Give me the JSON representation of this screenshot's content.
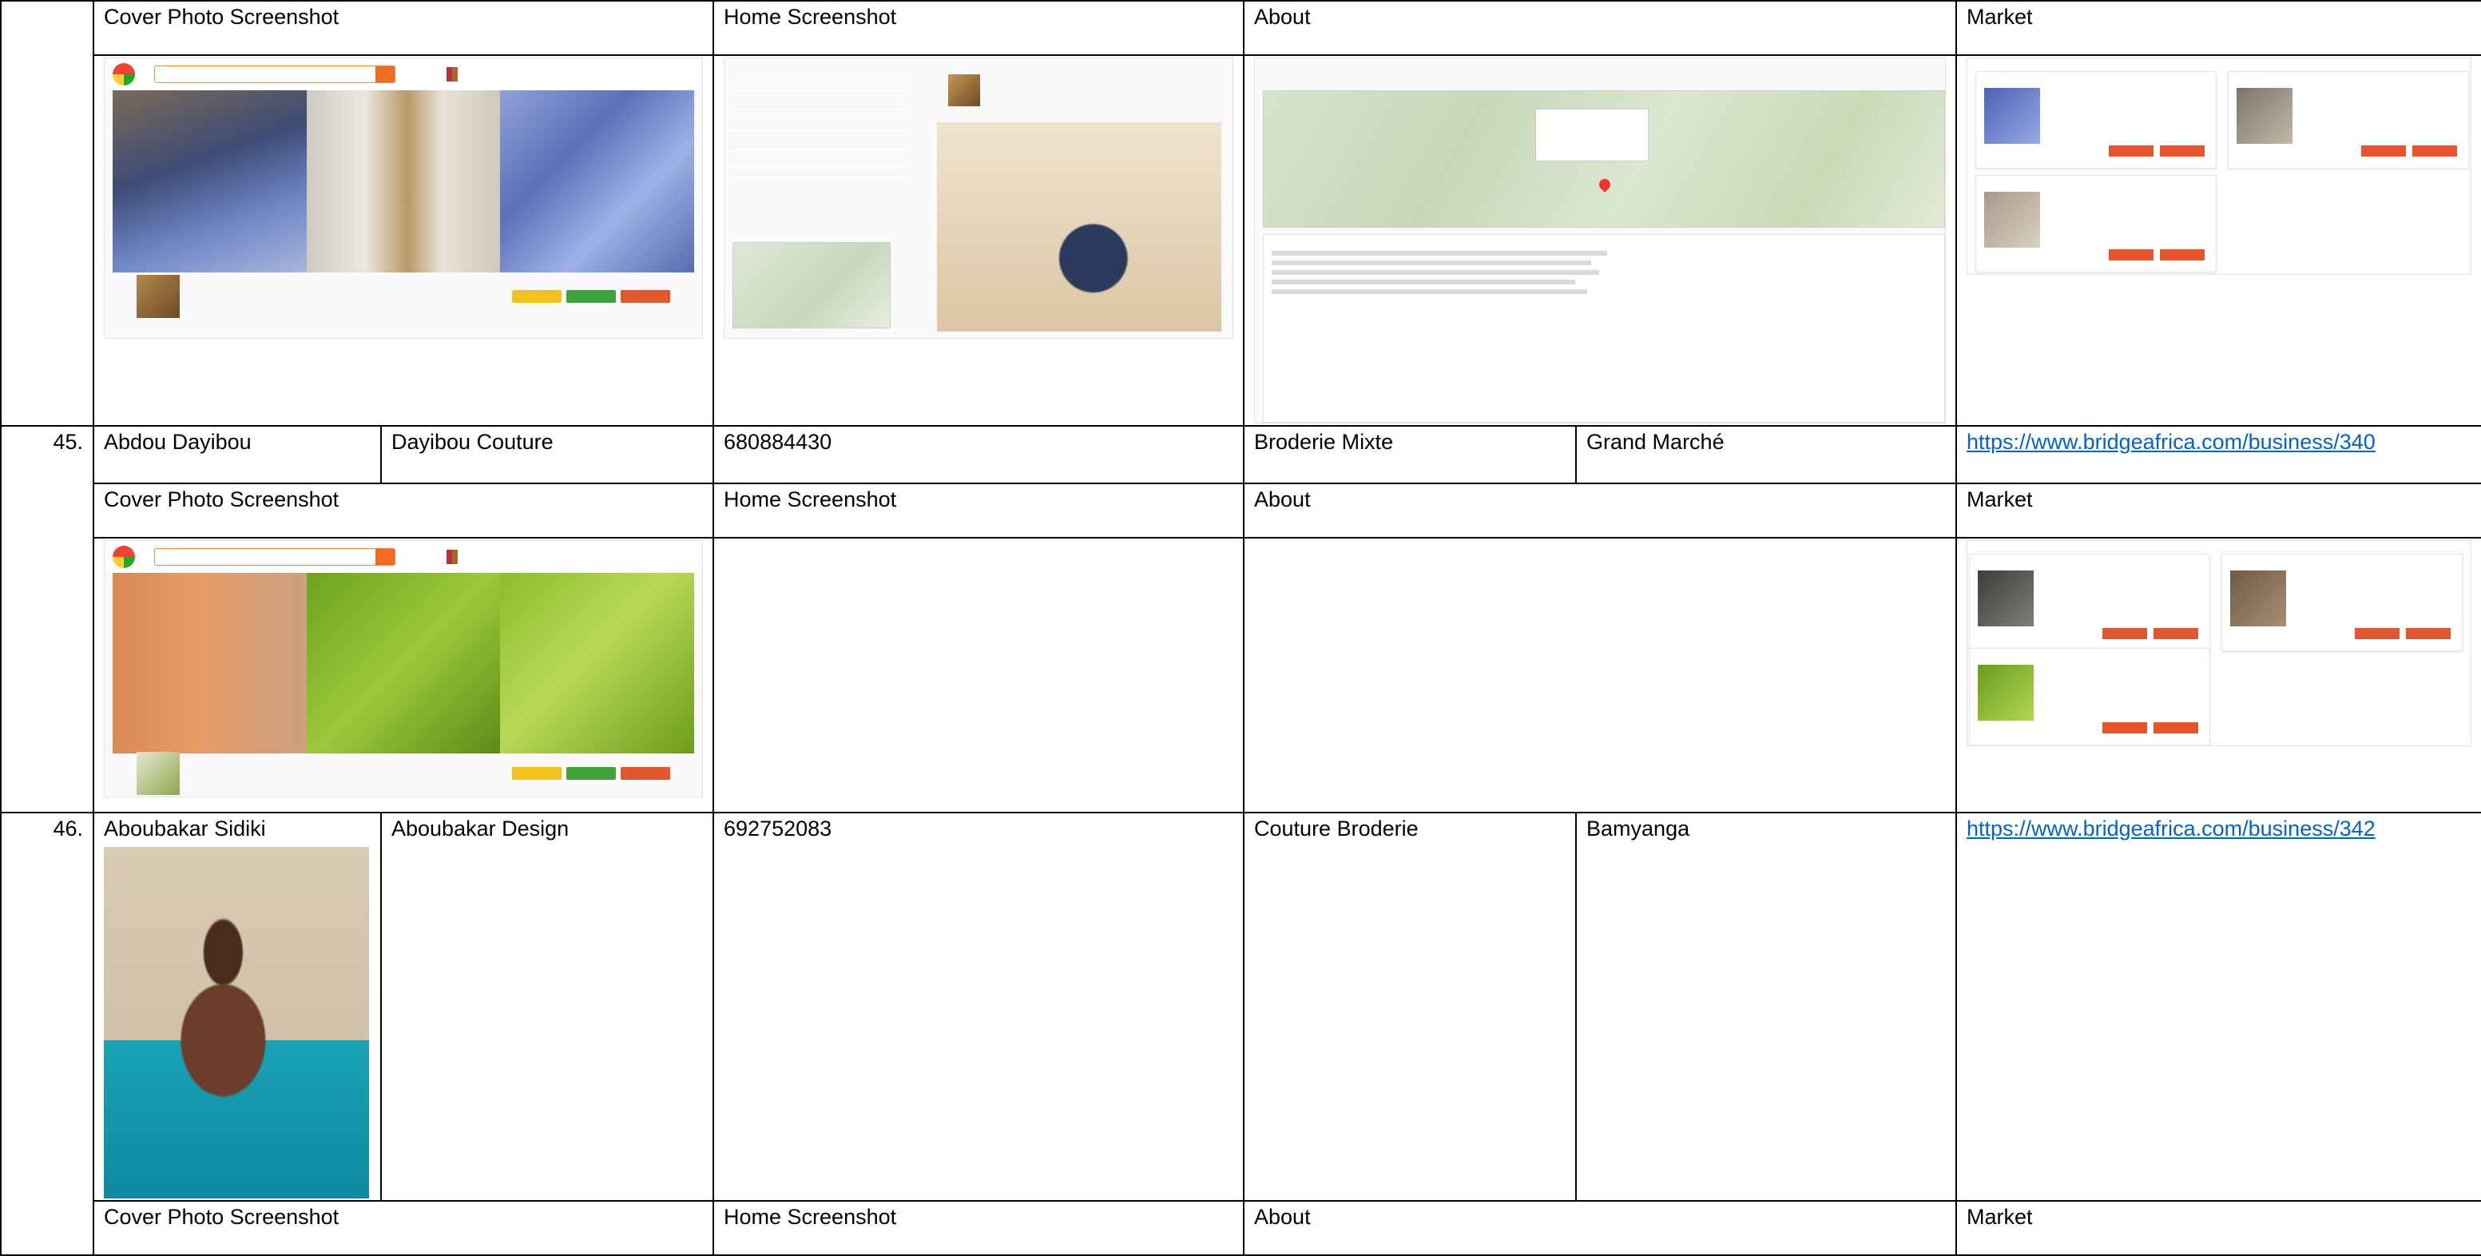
{
  "table": {
    "labels": {
      "cover": "Cover Photo Screenshot",
      "home": "Home Screenshot",
      "about": "About",
      "market": "Market"
    },
    "rows": [
      {
        "num": "45.",
        "name": "Abdou Dayibou",
        "business": "Dayibou Couture",
        "phone": "680884430",
        "category": "Broderie Mixte",
        "location": "Grand Marché",
        "url": "https://www.bridgeafrica.com/business/340"
      },
      {
        "num": "46.",
        "name": "Aboubakar Sidiki",
        "business": "Aboubakar Design",
        "phone": "692752083",
        "category": "Couture Broderie",
        "location": "Bamyanga",
        "url": "https://www.bridgeafrica.com/business/342"
      }
    ]
  }
}
